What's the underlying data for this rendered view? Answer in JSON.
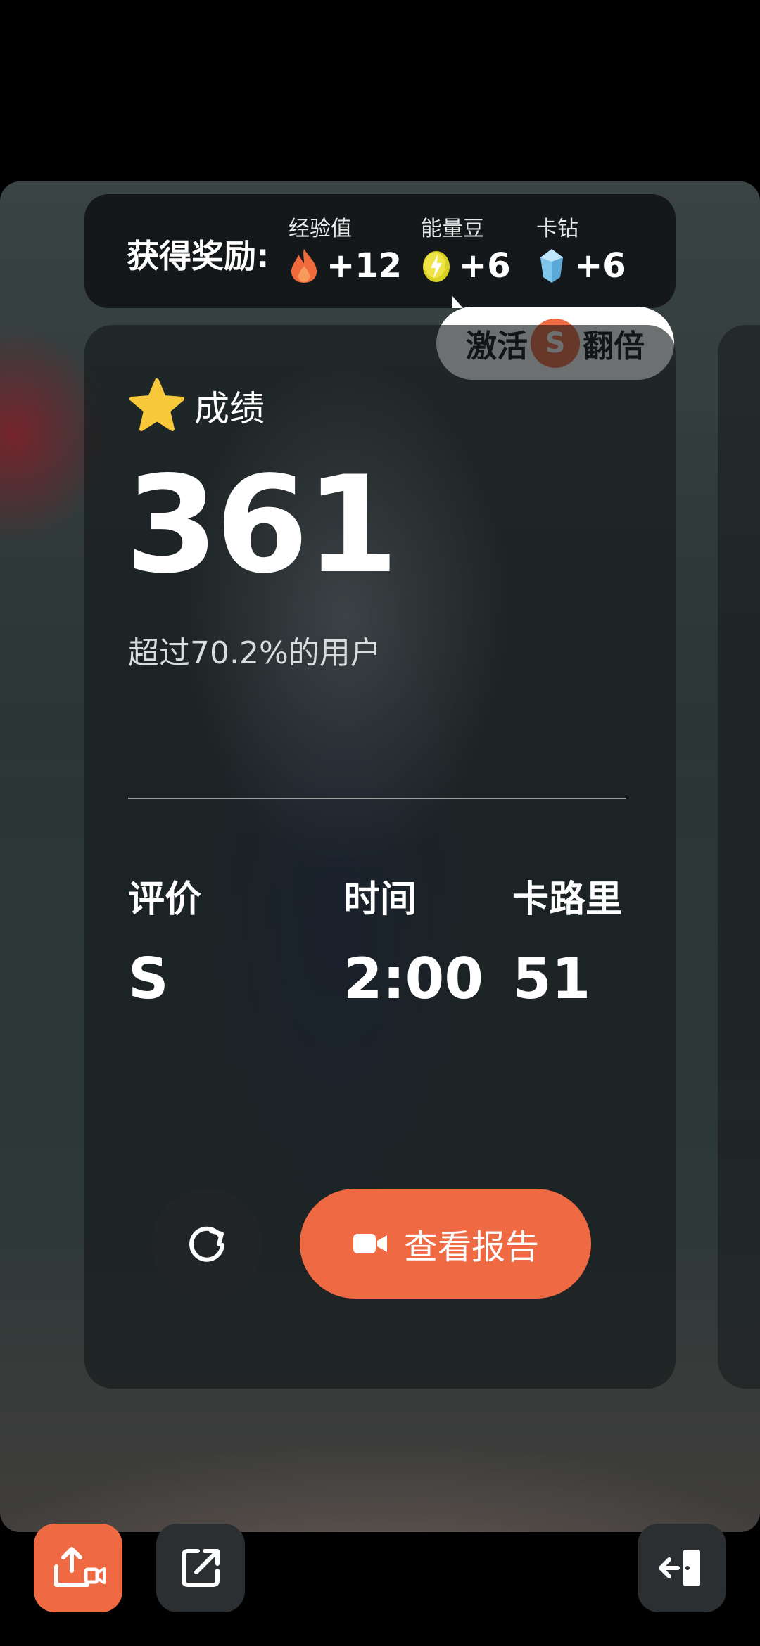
{
  "rewards": {
    "title": "获得奖励:",
    "items": [
      {
        "label": "经验值",
        "value": "+12",
        "icon": "flame-icon"
      },
      {
        "label": "能量豆",
        "value": "+6",
        "icon": "energy-bean-icon"
      },
      {
        "label": "卡钻",
        "value": "+6",
        "icon": "diamond-icon"
      }
    ],
    "activate": {
      "prefix": "激活",
      "badge": "S",
      "suffix": "翻倍"
    }
  },
  "result": {
    "label": "成绩",
    "score": "361",
    "percentile": "超过70.2%的用户",
    "stats": [
      {
        "label": "评价",
        "value": "S"
      },
      {
        "label": "时间",
        "value": "2:00"
      },
      {
        "label": "卡路里",
        "value": "51"
      }
    ],
    "report_button": "查看报告"
  },
  "colors": {
    "accent": "#ef6a43",
    "star": "#f7c83a",
    "card": "#14181a",
    "button_dark": "#2c2f31"
  }
}
